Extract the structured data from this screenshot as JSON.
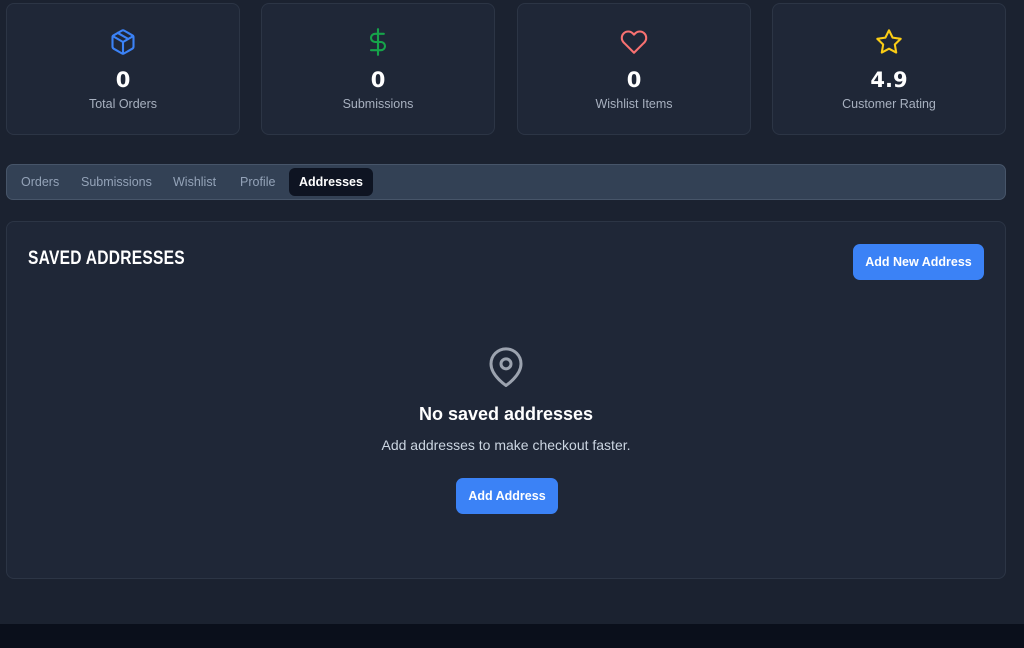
{
  "stats": [
    {
      "value": "0",
      "label": "Total Orders",
      "icon": "package-icon",
      "color": "#3b82f6"
    },
    {
      "value": "0",
      "label": "Submissions",
      "icon": "dollar-icon",
      "color": "#16a34a"
    },
    {
      "value": "0",
      "label": "Wishlist Items",
      "icon": "heart-icon",
      "color": "#f87171"
    },
    {
      "value": "4.9",
      "label": "Customer Rating",
      "icon": "star-icon",
      "color": "#facc15"
    }
  ],
  "tabs": [
    {
      "label": "Orders",
      "active": false
    },
    {
      "label": "Submissions",
      "active": false
    },
    {
      "label": "Wishlist",
      "active": false
    },
    {
      "label": "Profile",
      "active": false
    },
    {
      "label": "Addresses",
      "active": true
    }
  ],
  "addresses": {
    "title": "Saved Addresses",
    "add_new_label": "Add New Address",
    "empty_title": "No saved addresses",
    "empty_text": "Add addresses to make checkout faster.",
    "add_label": "Add Address",
    "empty_icon": "map-pin-icon"
  },
  "colors": {
    "background": "#1b2230",
    "card": "#1f2737",
    "accent": "#3b82f6",
    "tab_bar": "#334155",
    "active_tab": "#0e1422"
  }
}
